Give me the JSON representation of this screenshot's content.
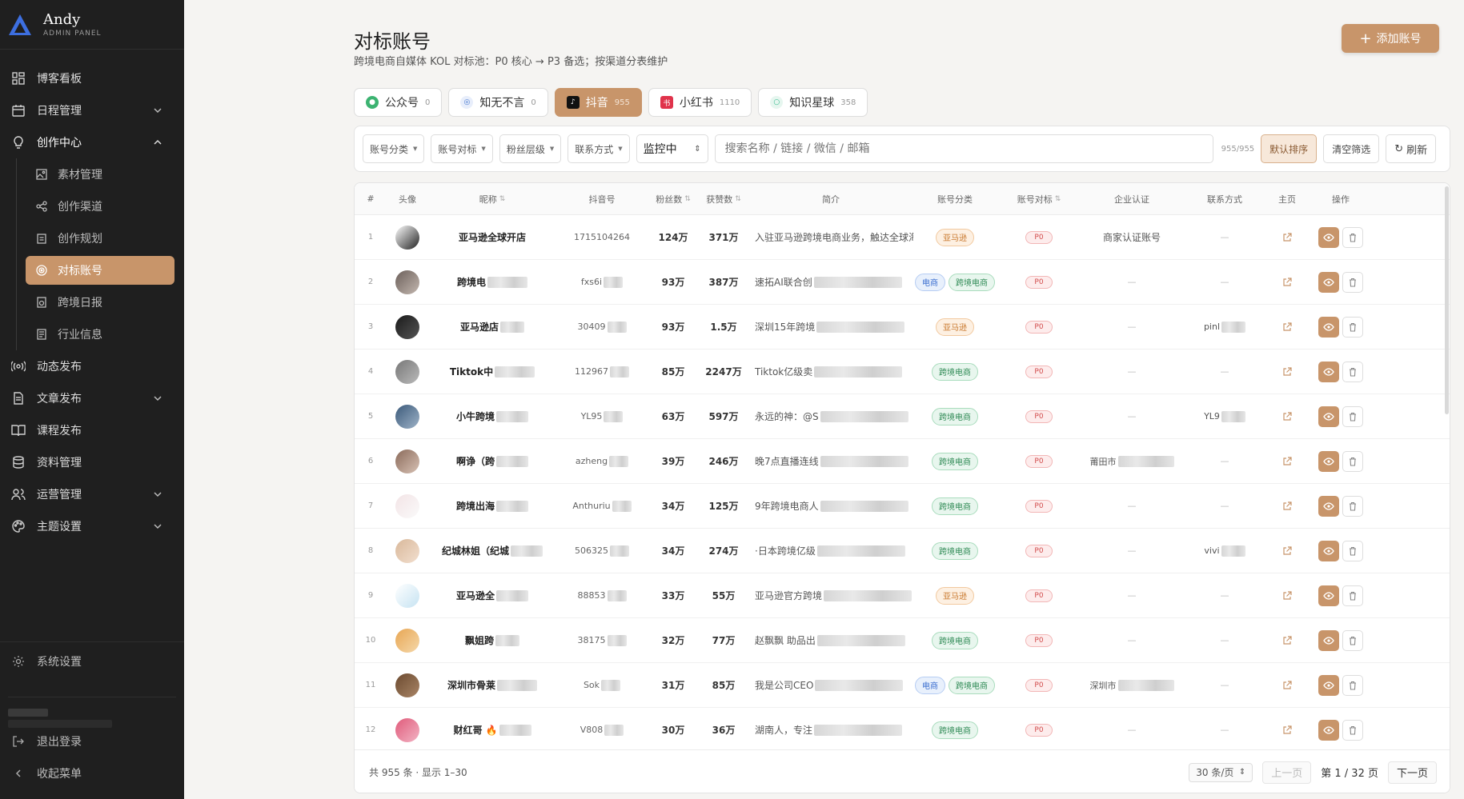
{
  "brand": {
    "name": "Andy",
    "sub": "ADMIN PANEL"
  },
  "nav": {
    "dashboard": "博客看板",
    "schedule": "日程管理",
    "creation": "创作中心",
    "creation_sub": [
      "素材管理",
      "创作渠道",
      "创作规划",
      "对标账号",
      "跨境日报",
      "行业信息"
    ],
    "dynamic": "动态发布",
    "article": "文章发布",
    "course": "课程发布",
    "resource": "资料管理",
    "operation": "运营管理",
    "theme": "主题设置",
    "settings": "系统设置",
    "logout": "退出登录",
    "collapse": "收起菜单"
  },
  "page": {
    "title": "对标账号",
    "subtitle": "跨境电商自媒体 KOL 对标池：P0 核心 → P3 备选；按渠道分表维护",
    "add_button": "添加账号"
  },
  "tabs": [
    {
      "label": "公众号",
      "count": "0",
      "color": "#3cb371",
      "icon": "wechat-icon"
    },
    {
      "label": "知无不言",
      "count": "0",
      "color": "#4a7bd0",
      "icon": "zhiwubuyan-icon"
    },
    {
      "label": "抖音",
      "count": "955",
      "color": "#111111",
      "icon": "douyin-icon"
    },
    {
      "label": "小红书",
      "count": "1110",
      "color": "#e0334b",
      "icon": "xiaohongshu-icon"
    },
    {
      "label": "知识星球",
      "count": "358",
      "color": "#30b98a",
      "icon": "zsxq-icon"
    }
  ],
  "filters": {
    "category": "账号分类",
    "benchmark": "账号对标",
    "fans_level": "粉丝层级",
    "contact": "联系方式",
    "monitor": "监控中",
    "search_placeholder": "搜索名称 / 链接 / 微信 / 邮箱",
    "count": "955/955",
    "default_sort": "默认排序",
    "clear": "清空筛选",
    "refresh": "刷新"
  },
  "table": {
    "headers": [
      "#",
      "头像",
      "昵称",
      "抖音号",
      "粉丝数",
      "获赞数",
      "简介",
      "账号分类",
      "账号对标",
      "企业认证",
      "联系方式",
      "主页",
      "操作"
    ],
    "rows": [
      {
        "idx": "1",
        "name": "亚马逊全球开店",
        "id": "1715104264",
        "fans": "124万",
        "likes": "371万",
        "intro": "入驻亚马逊跨境电商业务，触达全球海",
        "tags": [
          "亚马逊"
        ],
        "level": "P0",
        "cert": "商家认证账号",
        "contact": "—",
        "avatar": [
          "#ffffff",
          "#222222"
        ]
      },
      {
        "idx": "2",
        "name": "跨境电",
        "id": "fxs6i",
        "fans": "93万",
        "likes": "387万",
        "intro": "速拓AI联合创",
        "tags": [
          "电商",
          "跨境电商"
        ],
        "level": "P0",
        "cert": "—",
        "contact": "—",
        "avatar": [
          "#6b5f5a",
          "#c4b8b0"
        ]
      },
      {
        "idx": "3",
        "name": "亚马逊店",
        "id": "30409",
        "fans": "93万",
        "likes": "1.5万",
        "intro": "深圳15年跨境",
        "tags": [
          "亚马逊"
        ],
        "level": "P0",
        "cert": "—",
        "contact": "pinl",
        "avatar": [
          "#1a1a1a",
          "#555555"
        ]
      },
      {
        "idx": "4",
        "name": "Tiktok中",
        "id": "112967",
        "fans": "85万",
        "likes": "2247万",
        "intro": "Tiktok亿级卖",
        "tags": [
          "跨境电商"
        ],
        "level": "P0",
        "cert": "—",
        "contact": "—",
        "avatar": [
          "#777777",
          "#bbbbbb"
        ]
      },
      {
        "idx": "5",
        "name": "小牛跨境",
        "id": "YL95",
        "fans": "63万",
        "likes": "597万",
        "intro": "永远的神：@S",
        "tags": [
          "跨境电商"
        ],
        "level": "P0",
        "cert": "—",
        "contact": "YL9",
        "avatar": [
          "#3b5a7a",
          "#9fb3c8"
        ]
      },
      {
        "idx": "6",
        "name": "啊诤（跨",
        "id": "azheng",
        "fans": "39万",
        "likes": "246万",
        "intro": "晚7点直播连线",
        "tags": [
          "跨境电商"
        ],
        "level": "P0",
        "cert": "莆田市",
        "contact": "—",
        "avatar": [
          "#8a6a5a",
          "#d8c2b5"
        ]
      },
      {
        "idx": "7",
        "name": "跨境出海",
        "id": "Anthuriu",
        "fans": "34万",
        "likes": "125万",
        "intro": "9年跨境电商人",
        "tags": [
          "跨境电商"
        ],
        "level": "P0",
        "cert": "—",
        "contact": "—",
        "avatar": [
          "#f3e4e6",
          "#fafafa"
        ]
      },
      {
        "idx": "8",
        "name": "纪城林姐（纪城",
        "id": "506325",
        "fans": "34万",
        "likes": "274万",
        "intro": "·日本跨境亿级",
        "tags": [
          "跨境电商"
        ],
        "level": "P0",
        "cert": "—",
        "contact": "vivi",
        "avatar": [
          "#d9b89a",
          "#f2dfcf"
        ]
      },
      {
        "idx": "9",
        "name": "亚马逊全",
        "id": "88853",
        "fans": "33万",
        "likes": "55万",
        "intro": "亚马逊官方跨境",
        "tags": [
          "亚马逊"
        ],
        "level": "P0",
        "cert": "—",
        "contact": "—",
        "avatar": [
          "#ffffff",
          "#c6e3f2"
        ]
      },
      {
        "idx": "10",
        "name": "飘姐跨",
        "id": "38175",
        "fans": "32万",
        "likes": "77万",
        "intro": "赵飘飘 助品出",
        "tags": [
          "跨境电商"
        ],
        "level": "P0",
        "cert": "—",
        "contact": "—",
        "avatar": [
          "#e8a653",
          "#f5d8aa"
        ]
      },
      {
        "idx": "11",
        "name": "深圳市骨莱",
        "id": "Sok",
        "fans": "31万",
        "likes": "85万",
        "intro": "我是公司CEO",
        "tags": [
          "电商",
          "跨境电商"
        ],
        "level": "P0",
        "cert": "深圳市",
        "contact": "—",
        "avatar": [
          "#6b4a30",
          "#a98566"
        ]
      },
      {
        "idx": "12",
        "name": "财红哥 🔥",
        "id": "V808",
        "fans": "30万",
        "likes": "36万",
        "intro": "湖南人，专注",
        "tags": [
          "跨境电商"
        ],
        "level": "P0",
        "cert": "—",
        "contact": "—",
        "avatar": [
          "#e05a7a",
          "#f2b4c4"
        ]
      }
    ]
  },
  "footer": {
    "summary": "共 955 条 · 显示 1–30",
    "page_size": "30 条/页",
    "prev": "上一页",
    "page_info": "第 1 / 32 页",
    "next": "下一页"
  },
  "colors": {
    "accent": "#c8956a",
    "sidebar_bg": "#1f1f1f",
    "page_bg": "#f5f4f2"
  }
}
